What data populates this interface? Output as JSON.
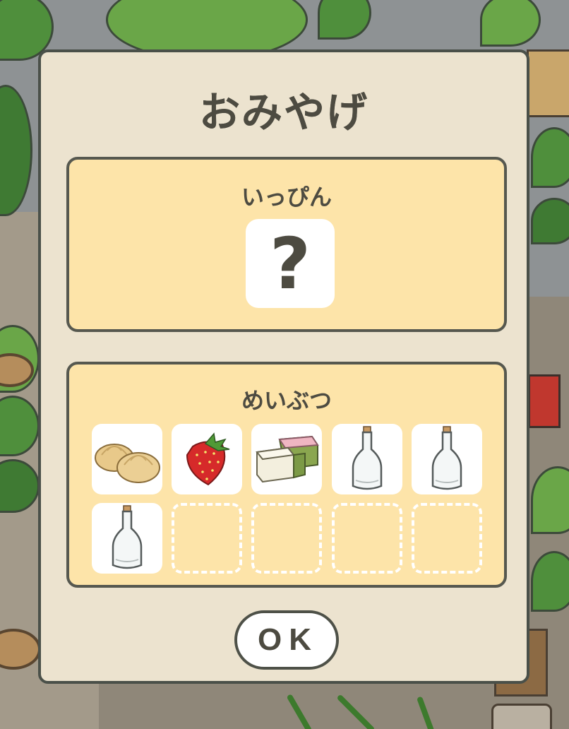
{
  "dialog": {
    "title": "おみやげ",
    "ok_label": "OK"
  },
  "special_panel": {
    "label": "いっぴん",
    "item": {
      "icon": "unknown-icon",
      "text": "?"
    }
  },
  "souvenir_panel": {
    "label": "めいぶつ",
    "items": [
      {
        "icon": "manju-icon",
        "filled": true
      },
      {
        "icon": "strawberry-icon",
        "filled": true
      },
      {
        "icon": "kashiwamochi-icon",
        "filled": true
      },
      {
        "icon": "glass-bottle-icon",
        "filled": true
      },
      {
        "icon": "glass-bottle-icon",
        "filled": true
      },
      {
        "icon": "glass-bottle-icon",
        "filled": true
      },
      {
        "icon": "empty-slot",
        "filled": false
      },
      {
        "icon": "empty-slot",
        "filled": false
      },
      {
        "icon": "empty-slot",
        "filled": false
      },
      {
        "icon": "empty-slot",
        "filled": false
      }
    ]
  },
  "colors": {
    "dialog_bg": "#ece3cf",
    "panel_bg": "#fde4a9",
    "outline": "#4d4b41"
  }
}
